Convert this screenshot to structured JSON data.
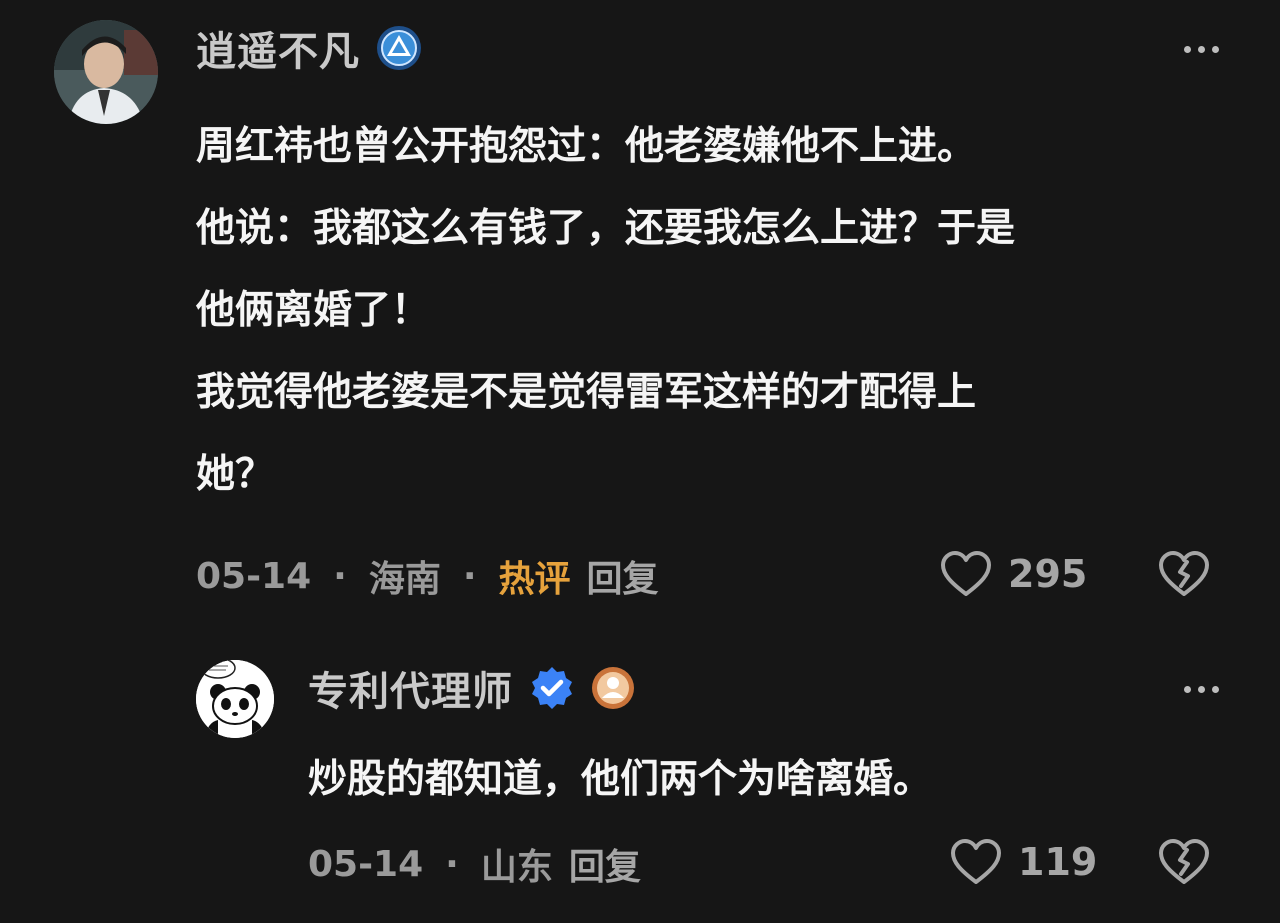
{
  "main_comment": {
    "username": "逍遥不凡",
    "avatar_icon": "user-avatar-photo",
    "badge_icon": "level-badge-icon",
    "body_lines": [
      "周红祎也曾公开抱怨过：他老婆嫌他不上进。",
      "他说：我都这么有钱了，还要我怎么上进？于是",
      "他俩离婚了！",
      "我觉得他老婆是不是觉得雷军这样的才配得上",
      "她？"
    ],
    "date": "05-14",
    "separator": "·",
    "location": "海南",
    "hot_tag": "热评",
    "reply_label": "回复",
    "like_count": "295",
    "hot_color": "#e6a23c"
  },
  "reply_comment": {
    "username": "专利代理师",
    "avatar_icon": "panda-avatar",
    "verified_icon": "verified-check-icon",
    "badge_icon": "user-level-badge-icon",
    "body": "炒股的都知道，他们两个为啥离婚。",
    "date": "05-14",
    "separator": "·",
    "location": "山东",
    "reply_label": "回复",
    "like_count": "119",
    "verified_color": "#3b82f6"
  }
}
